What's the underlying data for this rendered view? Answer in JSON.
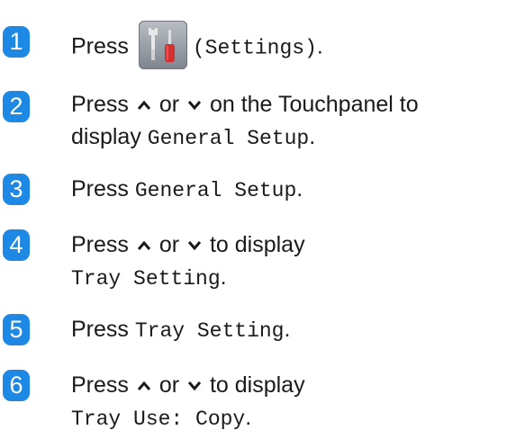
{
  "steps": [
    {
      "number": "1",
      "press": "Press",
      "settings_label": "(Settings)",
      "period": "."
    },
    {
      "number": "2",
      "press": "Press",
      "or": "or",
      "line1_tail": "on the Touchpanel to",
      "display": "display",
      "setting": "General Setup",
      "period": "."
    },
    {
      "number": "3",
      "press": "Press",
      "setting": "General Setup",
      "period": "."
    },
    {
      "number": "4",
      "press": "Press",
      "or": "or",
      "tail": "to display",
      "setting": "Tray Setting",
      "period": "."
    },
    {
      "number": "5",
      "press": "Press",
      "setting": "Tray Setting",
      "period": "."
    },
    {
      "number": "6",
      "press": "Press",
      "or": "or",
      "tail": "to display",
      "setting": "Tray Use: Copy",
      "period": "."
    }
  ],
  "icons": {
    "settings": "settings-icon",
    "up": "chevron-up-icon",
    "down": "chevron-down-icon"
  },
  "colors": {
    "step_badge": "#1e88e5"
  }
}
